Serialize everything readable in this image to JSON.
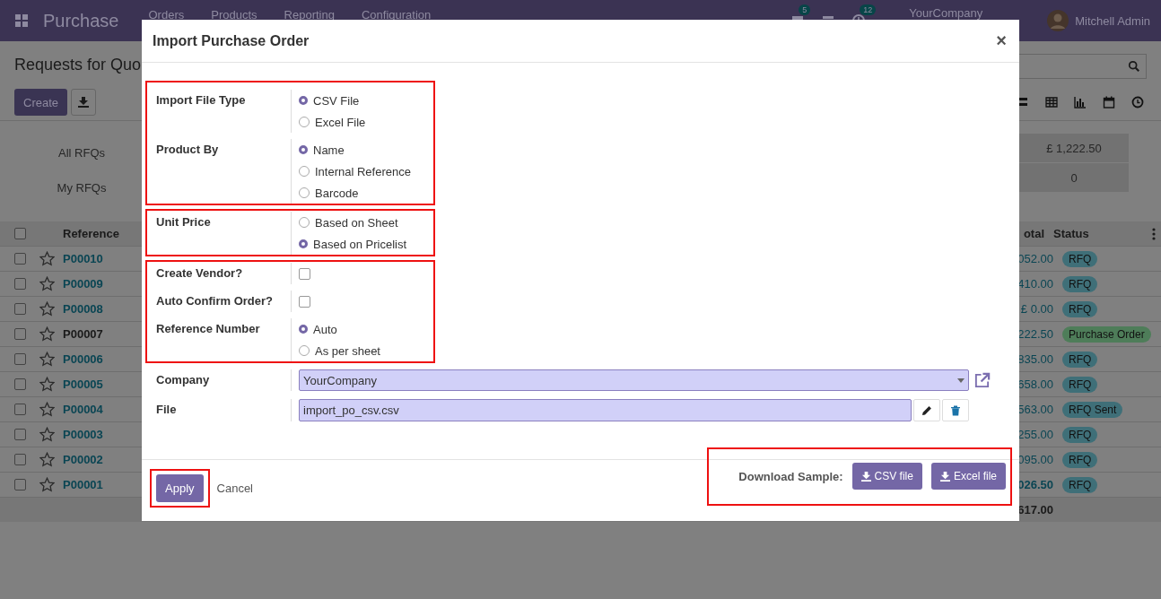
{
  "navbar": {
    "app": "Purchase",
    "menus": [
      "Orders",
      "Products",
      "Reporting",
      "Configuration"
    ],
    "message_count": "5",
    "activity_count": "12",
    "company": "YourCompany",
    "user": "Mitchell Admin"
  },
  "control_panel": {
    "title": "Requests for Quo",
    "create": "Create"
  },
  "filters": [
    "All RFQs",
    "My RFQs"
  ],
  "summary": [
    "£ 1,222.50",
    "0"
  ],
  "table": {
    "all_checked": false,
    "columns": [
      "Reference",
      "otal",
      "Status"
    ],
    "rows": [
      {
        "checked": false,
        "reference": "P00010",
        "link": true,
        "total": "052.00",
        "total_bold": false,
        "status": "RFQ",
        "color": "#3f6f78"
      },
      {
        "checked": false,
        "reference": "P00009",
        "link": true,
        "total": "410.00",
        "total_bold": false,
        "status": "RFQ",
        "color": "#3f6f78"
      },
      {
        "checked": false,
        "reference": "P00008",
        "link": true,
        "total": "£ 0.00",
        "total_bold": false,
        "status": "RFQ",
        "color": "#3f6f78"
      },
      {
        "checked": false,
        "reference": "P00007",
        "link": false,
        "total": "222.50",
        "total_bold": false,
        "status": "Purchase Order",
        "color": "#4e7d59"
      },
      {
        "checked": false,
        "reference": "P00006",
        "link": true,
        "total": "835.00",
        "total_bold": false,
        "status": "RFQ",
        "color": "#3f6f78"
      },
      {
        "checked": false,
        "reference": "P00005",
        "link": true,
        "total": "658.00",
        "total_bold": false,
        "status": "RFQ",
        "color": "#3f6f78"
      },
      {
        "checked": false,
        "reference": "P00004",
        "link": true,
        "total": "563.00",
        "total_bold": false,
        "status": "RFQ Sent",
        "color": "#3f6f78"
      },
      {
        "checked": false,
        "reference": "P00003",
        "link": true,
        "total": "255.00",
        "total_bold": false,
        "status": "RFQ",
        "color": "#3f6f78"
      },
      {
        "checked": false,
        "reference": "P00002",
        "link": true,
        "total": "095.00",
        "total_bold": false,
        "status": "RFQ",
        "color": "#3f6f78"
      },
      {
        "checked": false,
        "reference": "P00001",
        "link": true,
        "total": "026.50",
        "total_bold": true,
        "status": "RFQ",
        "color": "#3f6f78"
      }
    ],
    "footer_total": "617.00"
  },
  "dialog": {
    "title": "Import Purchase Order",
    "close": "×",
    "sections": [
      {
        "highlighted": true,
        "fields": [
          {
            "label": "Import File Type",
            "kind": "radio",
            "options": [
              {
                "label": "CSV File",
                "selected": true
              },
              {
                "label": "Excel File",
                "selected": false
              }
            ]
          },
          {
            "label": "Product By",
            "kind": "radio",
            "options": [
              {
                "label": "Name",
                "selected": true
              },
              {
                "label": "Internal Reference",
                "selected": false
              },
              {
                "label": "Barcode",
                "selected": false
              }
            ]
          }
        ]
      },
      {
        "highlighted": true,
        "fields": [
          {
            "label": "Unit Price",
            "kind": "radio",
            "options": [
              {
                "label": "Based on Sheet",
                "selected": false
              },
              {
                "label": "Based on Pricelist",
                "selected": true
              }
            ]
          }
        ]
      },
      {
        "highlighted": true,
        "fields": [
          {
            "label": "Create Vendor?",
            "kind": "checkbox",
            "checked": false
          },
          {
            "label": "Auto Confirm Order?",
            "kind": "checkbox",
            "checked": false
          },
          {
            "label": "Reference Number",
            "kind": "radio",
            "options": [
              {
                "label": "Auto",
                "selected": true
              },
              {
                "label": "As per sheet",
                "selected": false
              }
            ]
          }
        ]
      },
      {
        "highlighted": false,
        "fields": [
          {
            "label": "Company",
            "kind": "select",
            "value": "YourCompany"
          },
          {
            "label": "File",
            "kind": "file",
            "value": "import_po_csv.csv"
          }
        ]
      }
    ],
    "apply": {
      "label": "Apply",
      "highlighted": true
    },
    "cancel": "Cancel",
    "download": {
      "highlighted": true,
      "label": "Download Sample:",
      "buttons": [
        "CSV file",
        "Excel file"
      ]
    }
  }
}
